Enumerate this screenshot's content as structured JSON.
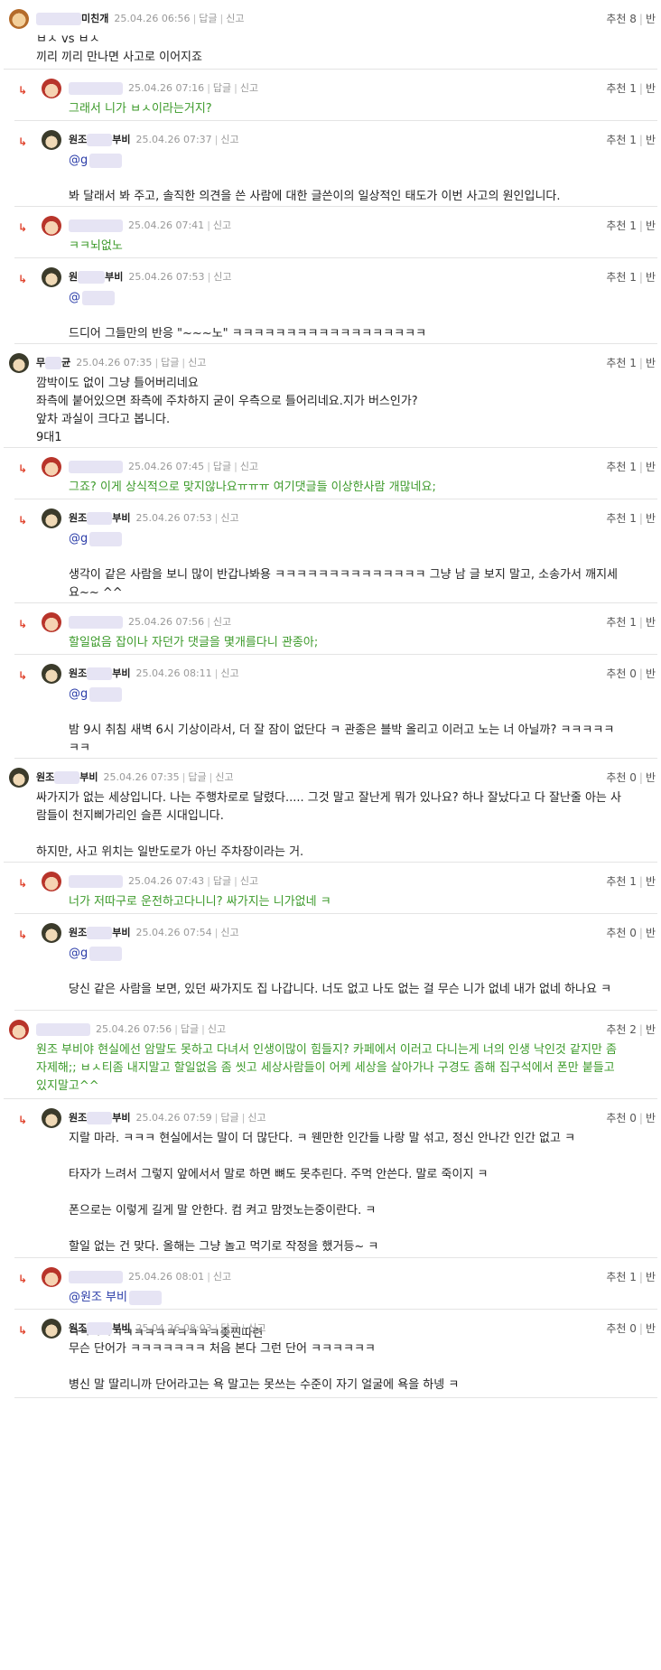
{
  "comments": [
    {
      "reply": false,
      "nick": "미친개",
      "date": "25.04.26 06:56",
      "actions": [
        "답글",
        "신고"
      ],
      "rec": "추천 8",
      "extra": "반",
      "lines": [
        "ㅂㅅ vs ㅂㅅ",
        "끼리 끼리 만나면 사고로 이어지죠"
      ]
    },
    {
      "reply": true,
      "nick": "",
      "date": "25.04.26 07:16",
      "actions": [
        "답글",
        "신고"
      ],
      "rec": "추천 1",
      "extra": "반",
      "lines": [
        "그래서 니가 ㅂㅅ이라는거지?"
      ]
    },
    {
      "reply": true,
      "nick": "원조 부비",
      "date": "25.04.26 07:37",
      "actions": [
        "신고"
      ],
      "rec": "추천 1",
      "extra": "반",
      "mention": "@g",
      "lines": [
        "봐 달래서 봐 주고, 솔직한 의견을 쓴 사람에 대한 글쓴이의 일상적인 태도가 이번 사고의 원인입니다."
      ]
    },
    {
      "reply": true,
      "nick": "",
      "date": "25.04.26 07:41",
      "actions": [
        "신고"
      ],
      "rec": "추천 1",
      "extra": "반",
      "lines": [
        "ㅋㅋ뇌없노"
      ]
    },
    {
      "reply": true,
      "nick": "원 부비",
      "date": "25.04.26 07:53",
      "actions": [
        "신고"
      ],
      "rec": "추천 1",
      "extra": "반",
      "mention": "@",
      "lines": [
        "드디어 그들만의 반응 \"~~~노\" ㅋㅋㅋㅋㅋㅋㅋㅋㅋㅋㅋㅋㅋㅋㅋㅋㅋㅋ"
      ]
    },
    {
      "reply": false,
      "nick": "무 균",
      "date": "25.04.26 07:35",
      "actions": [
        "답글",
        "신고"
      ],
      "rec": "추천 1",
      "extra": "반",
      "lines": [
        "깜박이도 없이 그냥 틀어버리네요",
        "좌측에 붙어있으면 좌측에 주차하지 굳이 우측으로 틀어리네요.지가 버스인가?",
        "앞차 과실이 크다고 봅니다.",
        "9대1"
      ]
    },
    {
      "reply": true,
      "nick": "",
      "date": "25.04.26 07:45",
      "actions": [
        "답글",
        "신고"
      ],
      "rec": "추천 1",
      "extra": "반",
      "lines": [
        "그죠? 이게 상식적으로 맞지않나요ㅠㅠㅠ 여기댓글들 이상한사람 개많네요;"
      ]
    },
    {
      "reply": true,
      "nick": "원조 부비",
      "date": "25.04.26 07:53",
      "actions": [
        "신고"
      ],
      "rec": "추천 1",
      "extra": "반",
      "mention": "@g",
      "lines": [
        "생각이 같은 사람을 보니 많이 반갑나봐용 ㅋㅋㅋㅋㅋㅋㅋㅋㅋㅋㅋㅋㅋㅋ 그냥 남 글 보지 말고, 소송가서 깨지세요~~ ^^"
      ]
    },
    {
      "reply": true,
      "nick": "",
      "date": "25.04.26 07:56",
      "actions": [
        "신고"
      ],
      "rec": "추천 1",
      "extra": "반",
      "lines": [
        "할일없음 잡이나 자던가 댓글을 몇개를다니 관종아;"
      ]
    },
    {
      "reply": true,
      "nick": "원조 부비",
      "date": "25.04.26 08:11",
      "actions": [
        "신고"
      ],
      "rec": "추천 0",
      "extra": "반",
      "mention": "@g",
      "lines": [
        "밤 9시 취침 새벽 6시 기상이라서, 더 잘 잠이 없단다 ㅋ 관종은 블박 올리고 이러고 노는 너 아닐까? ㅋㅋㅋㅋㅋㅋㅋ"
      ]
    },
    {
      "reply": false,
      "nick": "원조 부비",
      "date": "25.04.26 07:35",
      "actions": [
        "답글",
        "신고"
      ],
      "rec": "추천 0",
      "extra": "반",
      "lines": [
        "싸가지가 없는 세상입니다. 나는 주행차로로 달렸다..... 그것 말고 잘난게 뭐가 있나요? 하나 잘났다고 다 잘난줄 아는 사람들이 천지삐가리인 슬픈 시대입니다.",
        "",
        "하지만, 사고 위치는 일반도로가 아닌 주차장이라는 거."
      ]
    },
    {
      "reply": true,
      "nick": "",
      "date": "25.04.26 07:43",
      "actions": [
        "답글",
        "신고"
      ],
      "rec": "추천 1",
      "extra": "반",
      "lines": [
        "너가 저따구로 운전하고다니니? 싸가지는 니가없네 ㅋ"
      ]
    },
    {
      "reply": true,
      "nick": "원조 부비",
      "date": "25.04.26 07:54",
      "actions": [
        "신고"
      ],
      "rec": "추천 0",
      "extra": "반",
      "mention": "@g",
      "lines": [
        "당신 같은 사람을 보면, 있던 싸가지도 집 나갑니다. 너도 없고 나도 없는 걸 무슨 니가 없네 내가 없네 하나요 ㅋ"
      ]
    },
    {
      "reply": false,
      "nick": "",
      "date": "25.04.26 07:56",
      "actions": [
        "답글",
        "신고"
      ],
      "rec": "추천 2",
      "extra": "반",
      "lines": [
        "원조 부비야 현실에선 암말도 못하고 다녀서 인생이많이 힘들지? 카페에서 이러고 다니는게 너의 인생 낙인것 같지만 좀 자제해;; ㅂㅅ티좀 내지말고 할일없음 좀 씻고 세상사람들이 어케 세상을 살아가나 구경도 좀해 집구석에서 폰만 붙들고있지말고^^"
      ]
    },
    {
      "reply": true,
      "nick": "원조 부비",
      "date": "25.04.26 07:59",
      "actions": [
        "답글",
        "신고"
      ],
      "rec": "추천 0",
      "extra": "반",
      "lines": [
        "지랄 마라. ㅋㅋㅋ 현실에서는 말이 더 많단다. ㅋ 웬만한 인간들 나랑 말 섞고, 정신 안나간 인간 없고 ㅋ",
        "",
        "타자가 느려서 그렇지 앞에서서 말로 하면 뼈도 못추린다. 주먹 안쓴다. 말로 죽이지 ㅋ",
        "",
        "폰으로는 이렇게 길게 말 안한다. 컴 켜고 맘껏노는중이란다. ㅋ",
        "",
        "할일 없는 건 맞다. 올해는 그냥 놀고 먹기로 작정을 했거등~ ㅋ"
      ]
    },
    {
      "reply": true,
      "nick": "",
      "date": "25.04.26 08:01",
      "actions": [
        "신고"
      ],
      "rec": "추천 1",
      "extra": "반",
      "mention": "@원조 부비",
      "lines": [
        "ㅋㅋㅋㅋㅋㅋㅋㅋㅋㅋㅋㅋㅋㅋ좆찐따련"
      ]
    },
    {
      "reply": true,
      "nick": "원조 부비",
      "date": "25.04.26 08:03",
      "actions": [
        "답글",
        "신고"
      ],
      "rec": "추천 0",
      "extra": "반",
      "lines": [
        "무슨 단어가 ㅋㅋㅋㅋㅋㅋㅋ 처음 본다 그런 단어 ㅋㅋㅋㅋㅋㅋ",
        "",
        "병신 말 딸리니까 단어라고는 욕 말고는 못쓰는 수준이 자기 얼굴에 욕을 하넹 ㅋ"
      ]
    }
  ]
}
